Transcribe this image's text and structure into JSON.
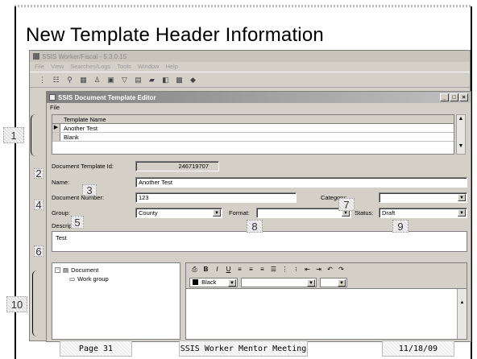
{
  "slide": {
    "title": "New Template Header Information",
    "footer": {
      "page": "Page 31",
      "meeting": "SSIS Worker Mentor Meeting",
      "date": "11/18/09"
    }
  },
  "app": {
    "title": "SSIS Worker/Fiscal - 5.3.0.15",
    "menu": [
      "File",
      "View",
      "Searches/Logs",
      "Tools",
      "Window",
      "Help"
    ]
  },
  "editor": {
    "title": "SSIS Document Template Editor",
    "menu": [
      "File"
    ],
    "grid": {
      "header": "Template Name",
      "rows": [
        "Another Test",
        "Blank"
      ]
    },
    "form": {
      "id_label": "Document Template Id:",
      "id_value": "246719707",
      "name_label": "Name:",
      "name_value": "Another Test",
      "docnum_label": "Document Number:",
      "docnum_value": "123",
      "category_label": "Category:",
      "category_value": "",
      "group_label": "Group:",
      "group_value": "County",
      "format_label": "Format:",
      "format_value": "",
      "status_label": "Status:",
      "status_value": "Draft",
      "description_label": "Description:",
      "description_value": "Test"
    },
    "tree": {
      "root": "Document",
      "child": "Work group"
    },
    "rte": {
      "color_value": "Black"
    }
  },
  "markers": [
    "1",
    "2",
    "3",
    "4",
    "5",
    "6",
    "7",
    "8",
    "9",
    "10"
  ]
}
